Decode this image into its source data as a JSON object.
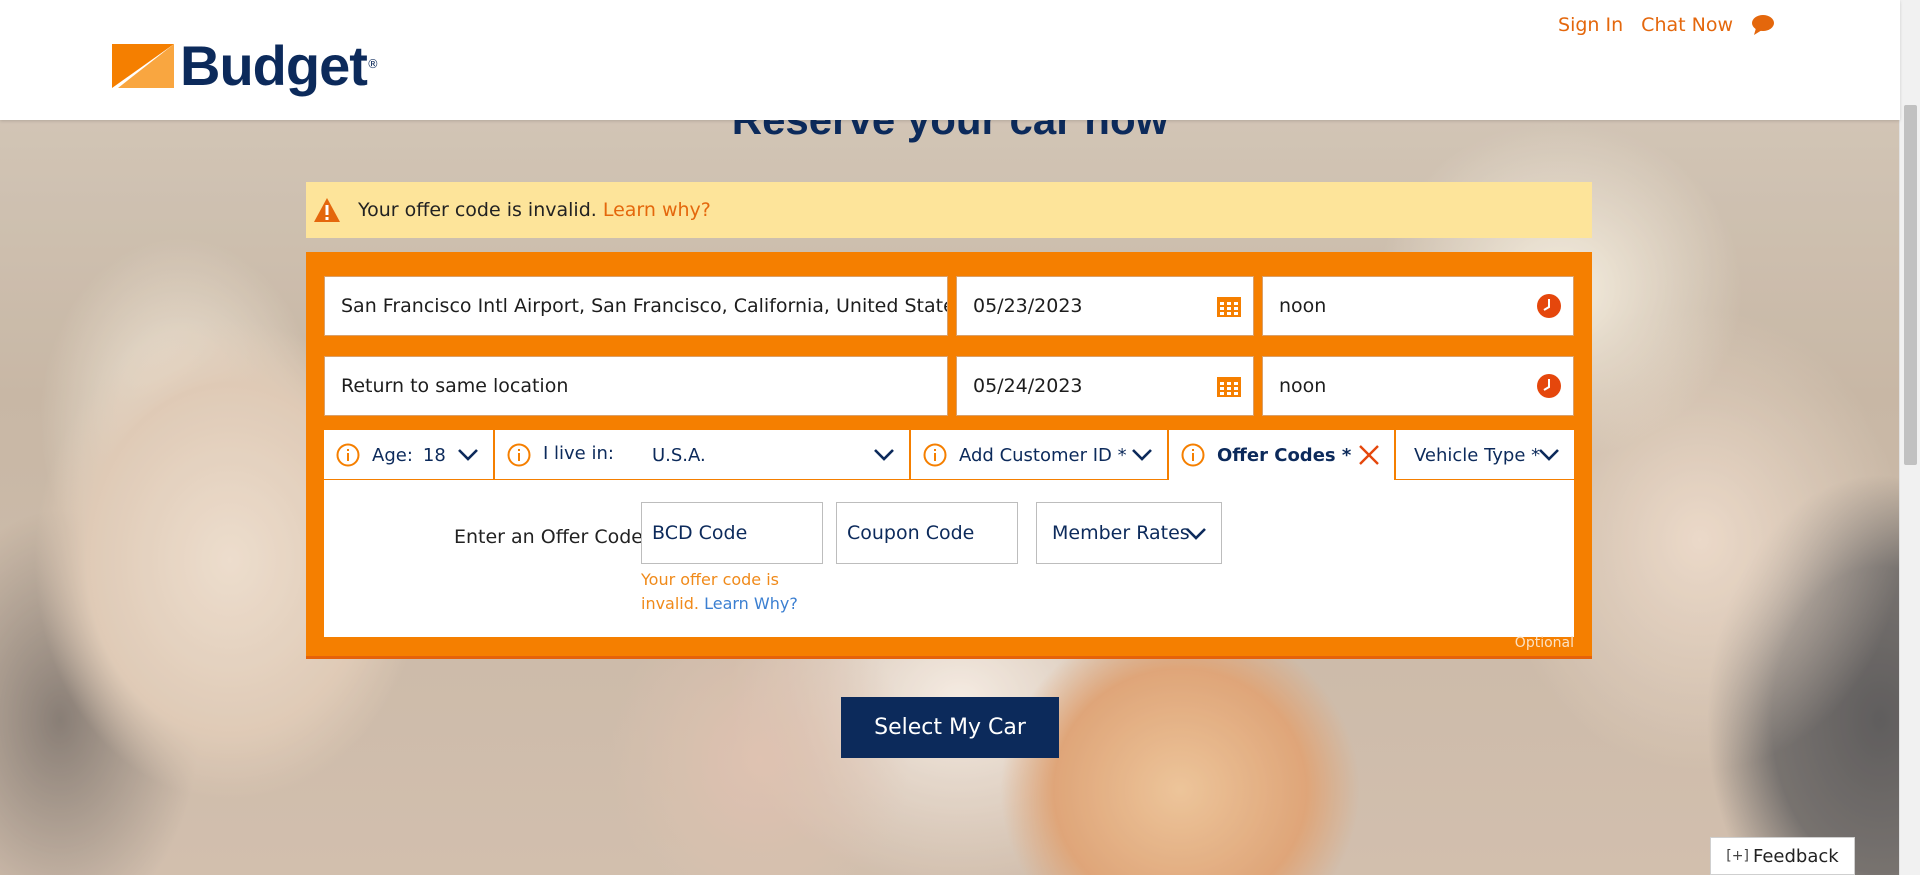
{
  "brand": {
    "name": "Budget",
    "reg": "®",
    "accent": "#f57f00",
    "navy": "#0c2a5b",
    "link_orange": "#e4670c"
  },
  "header": {
    "sign_in": "Sign In",
    "chat_now": "Chat Now",
    "chat_icon": "chat-bubble-icon"
  },
  "page": {
    "title": "Reserve your car now"
  },
  "alert": {
    "icon": "warning-icon",
    "message": "Your offer code is invalid.",
    "link": "Learn why?"
  },
  "booking": {
    "pickup_location": "San Francisco Intl Airport, San Francisco, California, United States-",
    "pickup_date": "05/23/2023",
    "pickup_time": "noon",
    "return_location": "Return to same location",
    "return_date": "05/24/2023",
    "return_time": "noon"
  },
  "options": {
    "age_label": "Age:",
    "age_value": "18",
    "live_label": "I live in:",
    "live_value": "U.S.A.",
    "customer_id": "Add Customer ID *",
    "offer_codes": "Offer Codes *",
    "vehicle_type": "Vehicle Type *"
  },
  "offer": {
    "label": "Enter an Offer Code",
    "bcd_placeholder": "BCD Code",
    "coupon_placeholder": "Coupon Code",
    "member_rates": "Member Rates",
    "error_text": "Your offer code is invalid.",
    "error_link": "Learn Why?",
    "optional": "Optional"
  },
  "cta": {
    "label": "Select My Car"
  },
  "feedback": {
    "plus": "[+]",
    "label": "Feedback"
  }
}
